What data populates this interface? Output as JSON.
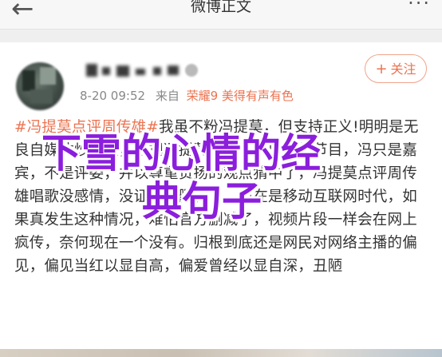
{
  "header": {
    "back_glyph": "←",
    "title": "微博正文",
    "more_glyph": "···"
  },
  "post": {
    "time": "8-20 09:52",
    "source_prefix": "来自",
    "device": "荣耀9 美得有声有色",
    "follow_label": "关注",
    "follow_plus": "+",
    "topic": "#冯提莫点评周传雄#",
    "text": "我虽不粉冯提莫，但支持正义!明明是无良自媒体炒热点，无视冯提莫跑调一个原唱的节目，冯只是嘉宾，不是评委，并以尊重贯扬的观点猜中了，冯提莫点评周传雄唱歌没感情，没证据说删减了，现在是移动互联网时代，如果真发生这种情况，难怕官方删减了，视频片段一样会在网上疯传，奈何现在一个没有。归根到底还是网民对网络主播的偏见，偏见当红以显自高，偏爱曾经以显自深，丑陋"
  },
  "overlay": {
    "line1": "下雪的心情的经",
    "line2": "典句子",
    "color": "#8b1edc"
  },
  "colors": {
    "accent": "#eb7350"
  },
  "icons": [
    "back-arrow-icon",
    "more-icon",
    "plus-icon"
  ]
}
